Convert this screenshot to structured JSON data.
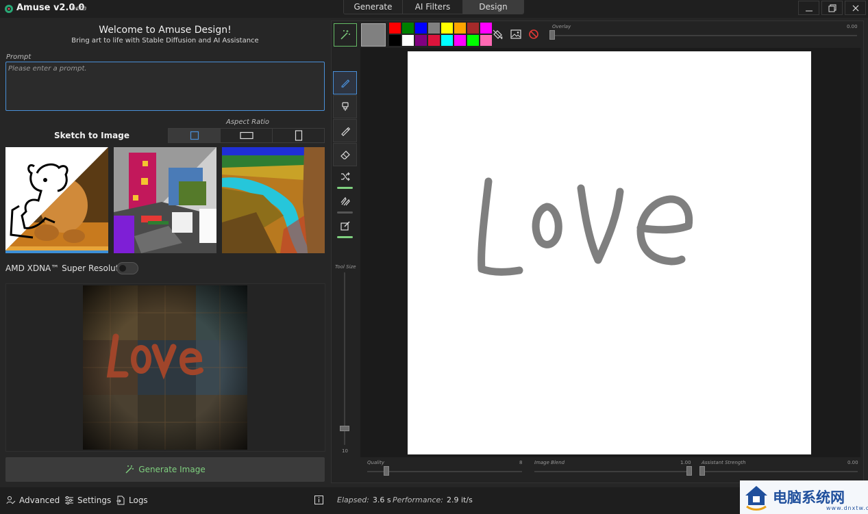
{
  "app": {
    "title": "Amuse v2.0.0",
    "beta": "beta"
  },
  "tabs": [
    {
      "label": "Generate"
    },
    {
      "label": "AI Filters"
    },
    {
      "label": "Design"
    }
  ],
  "window_controls": [
    "minimize-icon",
    "restore-icon",
    "close-icon"
  ],
  "welcome": {
    "title": "Welcome to Amuse Design!",
    "subtitle": "Bring art to life with Stable Diffusion and AI Assistance"
  },
  "prompt": {
    "label": "Prompt",
    "placeholder": "Please enter a prompt.",
    "value": ""
  },
  "mode": {
    "label": "Sketch to Image"
  },
  "aspect_ratio": {
    "label": "Aspect Ratio",
    "options": [
      "square",
      "landscape",
      "portrait"
    ],
    "selected": "square"
  },
  "presets": [
    {
      "name": "teddy-bear-sketch",
      "selected": true
    },
    {
      "name": "room-interior",
      "selected": false
    },
    {
      "name": "canyon-river",
      "selected": false
    }
  ],
  "xdna": {
    "label": "AMD XDNA™ Super Resolution",
    "enabled": false
  },
  "generate": {
    "label": "Generate Image"
  },
  "statusbar": {
    "advanced": "Advanced",
    "settings": "Settings",
    "logs": "Logs",
    "elapsed_label": "Elapsed:",
    "elapsed_value": "3.6 s",
    "performance_label": "Performance:",
    "performance_value": "2.9 it/s"
  },
  "design": {
    "current_color": "#808080",
    "palette": [
      "#ff0000",
      "#008000",
      "#0000ff",
      "#808080",
      "#ffff00",
      "#ffa500",
      "#a52a2a",
      "#ff00ff",
      "#000000",
      "#ffffff",
      "#800080",
      "#dc143c",
      "#00ffff",
      "#ff00ff",
      "#00ff00",
      "#ff69b4"
    ],
    "overlay": {
      "label": "Overlay",
      "value": "0.00"
    },
    "tool_size": {
      "label": "Tool Size",
      "value": "10"
    },
    "quality": {
      "label": "Quality",
      "value": "8"
    },
    "image_blend": {
      "label": "Image Blend",
      "value": "1.00"
    },
    "assistant_strength": {
      "label": "Assistant Strength",
      "value": "0.00"
    }
  },
  "watermark": {
    "title": "电脑系统网",
    "sub": "www.dnxtw.com"
  }
}
